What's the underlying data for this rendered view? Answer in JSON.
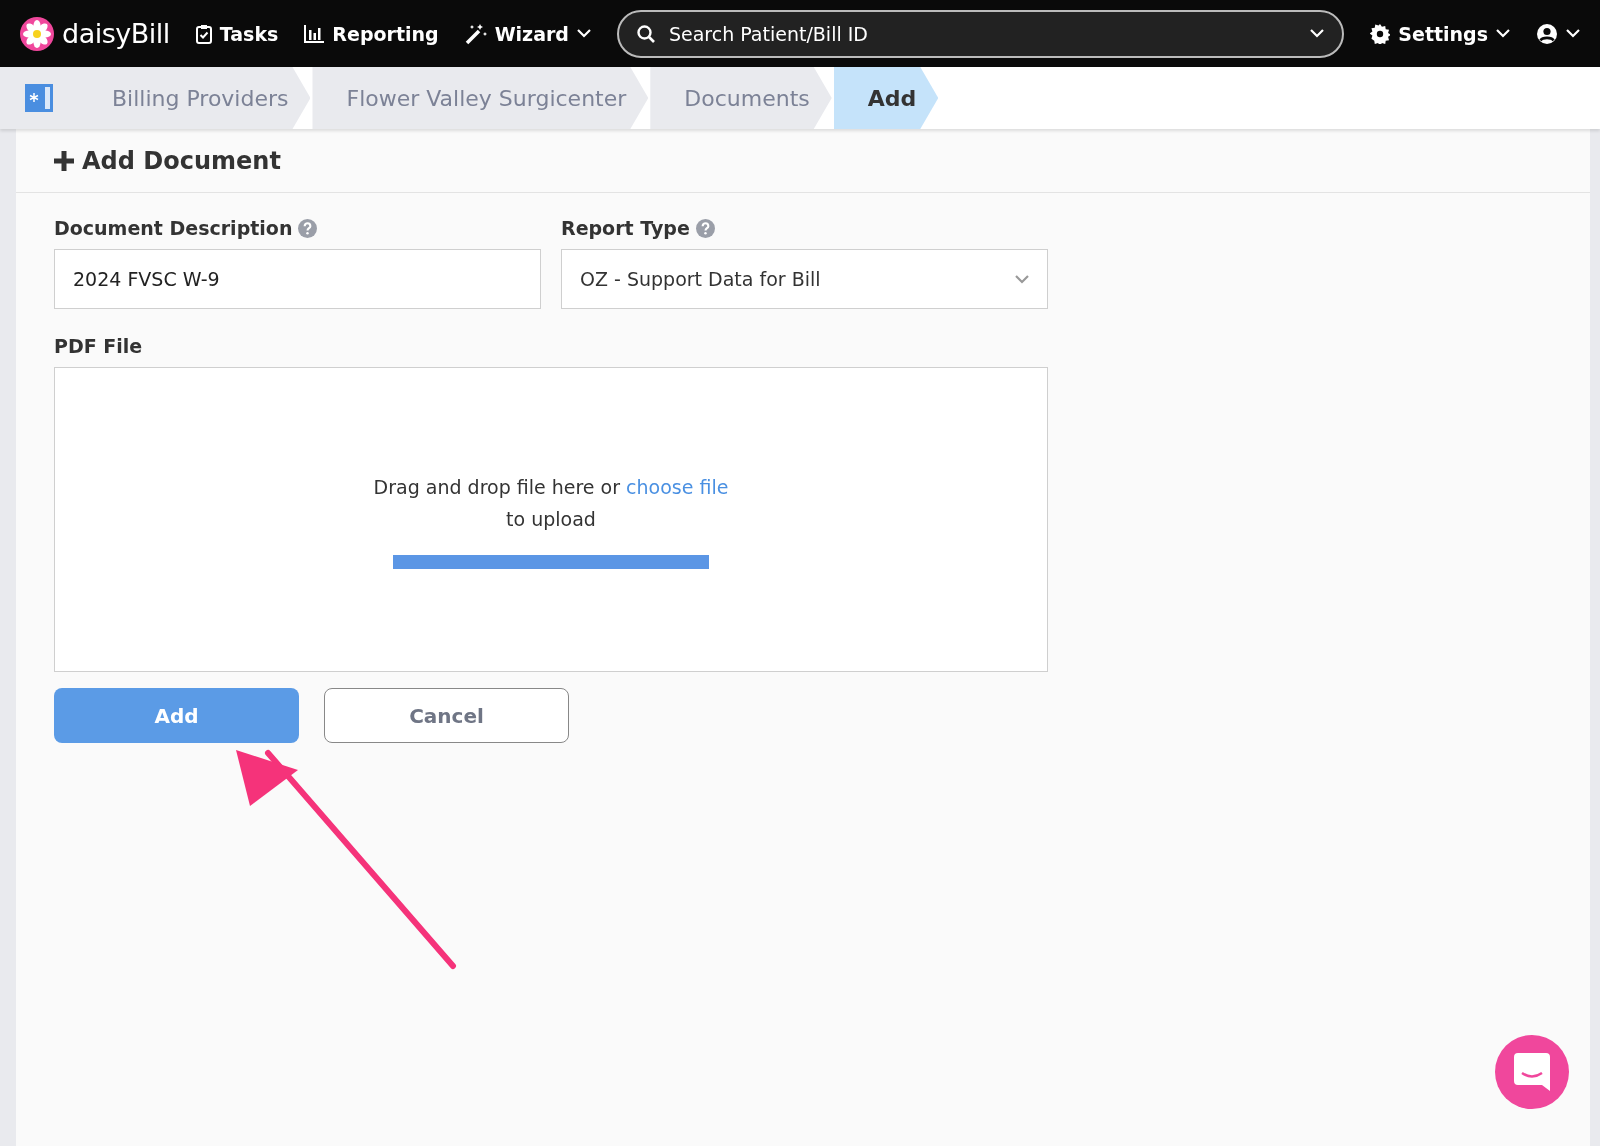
{
  "navbar": {
    "logo": "daisyBill",
    "items": [
      {
        "label": "Tasks",
        "kind": "tasks",
        "dropdown": false
      },
      {
        "label": "Reporting",
        "kind": "reporting",
        "dropdown": false
      },
      {
        "label": "Wizard",
        "kind": "wizard",
        "dropdown": true
      }
    ],
    "search": {
      "placeholder": "Search Patient/Bill ID"
    },
    "settings": {
      "label": "Settings"
    }
  },
  "breadcrumb": [
    {
      "label": "Billing Providers",
      "selected": false
    },
    {
      "label": "Flower Valley Surgicenter",
      "selected": false
    },
    {
      "label": "Documents",
      "selected": false
    },
    {
      "label": "Add",
      "selected": true
    }
  ],
  "form": {
    "title": "Add Document",
    "description": {
      "label": "Document Description",
      "value": "2024 FVSC W-9"
    },
    "report_type": {
      "label": "Report Type",
      "value": "OZ - Support Data for Bill"
    },
    "pdf_file": {
      "label": "PDF File",
      "prompt": "Drag and drop file here or",
      "link": "choose file",
      "prompt_end": "to upload",
      "level": 1
    },
    "buttons": [
      {
        "label": "Add",
        "kind": "primary"
      },
      {
        "label": "Cancel",
        "kind": "secondary"
      }
    ]
  }
}
